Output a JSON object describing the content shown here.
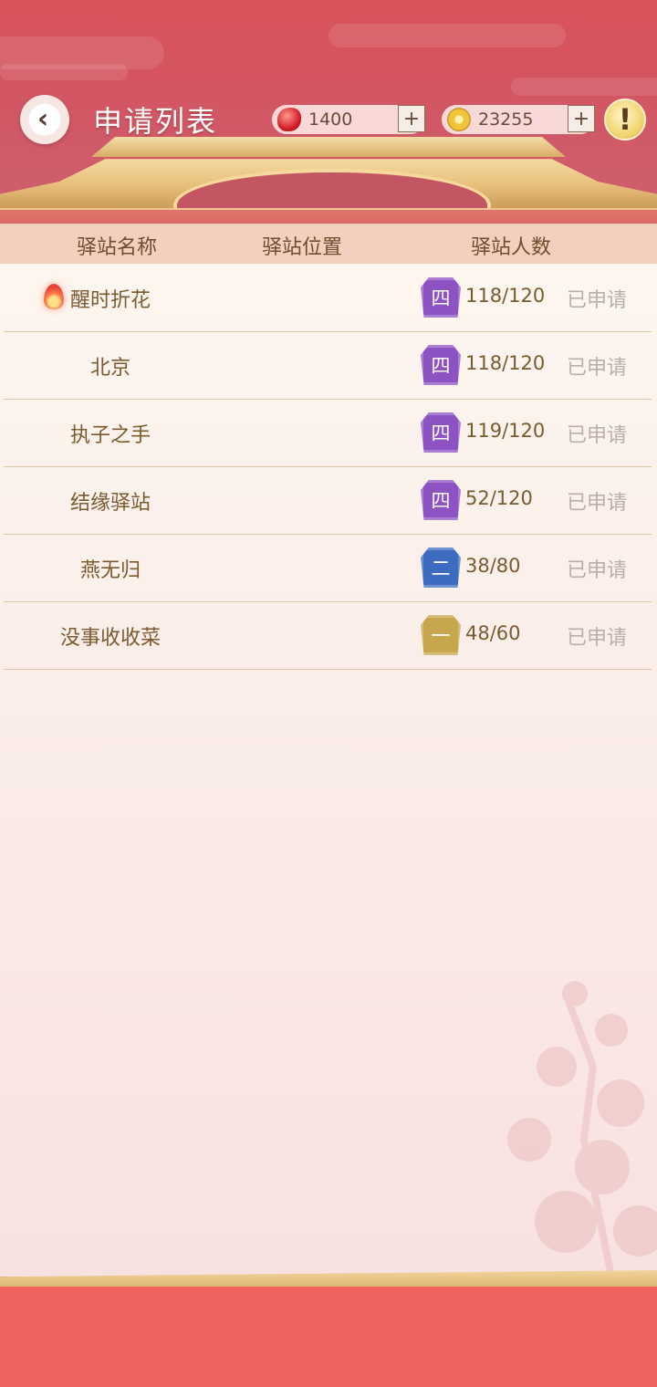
{
  "header": {
    "title": "申请列表",
    "currency_gem": "1400",
    "currency_coin": "23255",
    "plus_label": "+",
    "info_label": "!",
    "back_label": "‹"
  },
  "columns": {
    "name": "驿站名称",
    "location": "驿站位置",
    "count": "驿站人数"
  },
  "stations": [
    {
      "name": "醒时折花",
      "hot": true,
      "level": "四",
      "level_color": "#8e53c2",
      "count": "118/120",
      "status": "已申请"
    },
    {
      "name": "北京",
      "hot": false,
      "level": "四",
      "level_color": "#8e53c2",
      "count": "118/120",
      "status": "已申请"
    },
    {
      "name": "执子之手",
      "hot": false,
      "level": "四",
      "level_color": "#8e53c2",
      "count": "119/120",
      "status": "已申请"
    },
    {
      "name": "结缘驿站",
      "hot": false,
      "level": "四",
      "level_color": "#8e53c2",
      "count": "52/120",
      "status": "已申请"
    },
    {
      "name": "燕无归",
      "hot": false,
      "level": "二",
      "level_color": "#3c6bc0",
      "count": "38/80",
      "status": "已申请"
    },
    {
      "name": "没事收收菜",
      "hot": false,
      "level": "一",
      "level_color": "#c7a64e",
      "count": "48/60",
      "status": "已申请"
    }
  ],
  "colors": {
    "header_red": "#d9535a",
    "gold": "#e8c07b",
    "bottom_red": "#f0625f"
  }
}
